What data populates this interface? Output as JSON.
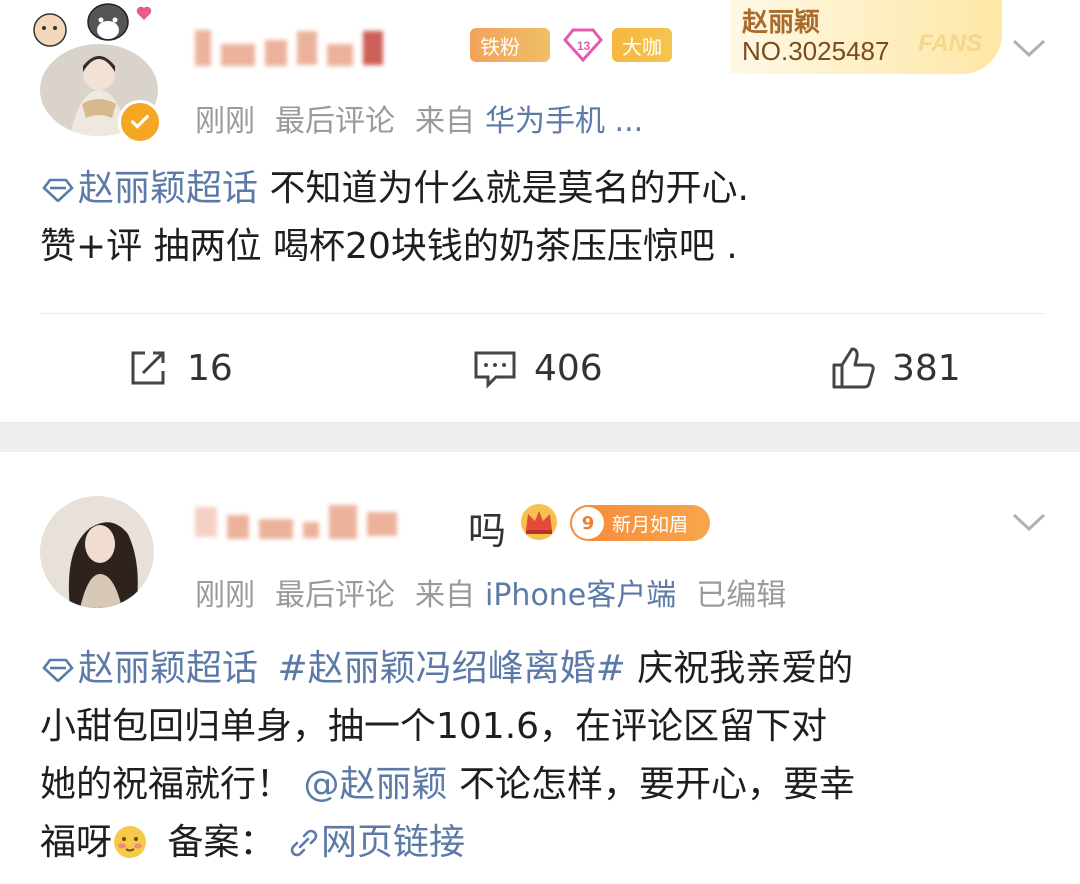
{
  "post1": {
    "badges": {
      "tiefen": "铁粉",
      "level": "13",
      "daka": "大咖"
    },
    "fans_card": {
      "name": "赵丽颖",
      "number": "NO.3025487",
      "word": "FANS"
    },
    "meta": {
      "time": "刚刚",
      "activity": "最后评论",
      "source_prefix": "来自",
      "source": "华为手机 ..."
    },
    "topic": "赵丽颖超话",
    "text_line1": "不知道为什么就是莫名的开心.",
    "text_line2": "赞+评 抽两位 喝杯20块钱的奶茶压压惊吧 .",
    "actions": {
      "repost": "16",
      "comment": "406",
      "like": "381"
    }
  },
  "post2": {
    "name_tail": "吗",
    "badge": {
      "level": "9",
      "label": "新月如眉"
    },
    "meta": {
      "time": "刚刚",
      "activity": "最后评论",
      "source_prefix": "来自",
      "source": "iPhone客户端",
      "edited": "已编辑"
    },
    "topic": "赵丽颖超话",
    "hashtag": "#赵丽颖冯绍峰离婚#",
    "text_a": "庆祝我亲爱的",
    "text_b": "小甜包回归单身，抽一个101.6，在评论区留下对",
    "text_c": "她的祝福就行！",
    "mention": "@赵丽颖",
    "text_d": "不论怎样，要开心，要幸",
    "text_e": "福呀",
    "text_f": "备案：",
    "link": "网页链接"
  },
  "colors": {
    "link": "#5b7aa8",
    "meta": "#9a9a9a",
    "accent_orange": "#f5a623"
  }
}
